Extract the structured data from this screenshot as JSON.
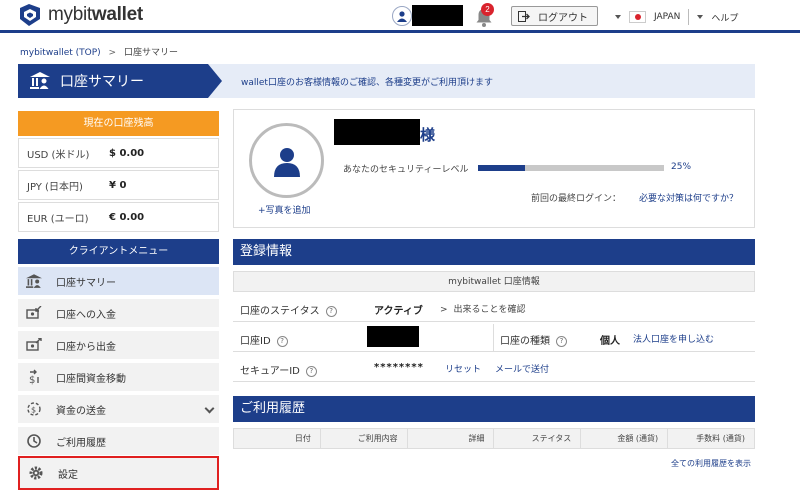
{
  "header": {
    "logo_text_light": "mybit",
    "logo_text_bold": "wallet",
    "notification_count": "2",
    "logout_label": "ログアウト",
    "language": "JAPAN",
    "help_label": "ヘルプ"
  },
  "breadcrumb": {
    "home": "mybitwallet (TOP)",
    "arrow": ">",
    "current": "口座サマリー"
  },
  "page": {
    "title": "口座サマリー",
    "description": "wallet口座のお客様情報のご確認、各種変更がご利用頂けます"
  },
  "balance": {
    "heading": "現在の口座残高",
    "rows": [
      {
        "currency": "USD (米ドル)",
        "amount": "$ 0.00"
      },
      {
        "currency": "JPY (日本円)",
        "amount": "¥ 0"
      },
      {
        "currency": "EUR (ユーロ)",
        "amount": "€ 0.00"
      }
    ]
  },
  "menu": {
    "heading": "クライアントメニュー",
    "items": [
      {
        "label": "口座サマリー",
        "icon": "bank-user-icon"
      },
      {
        "label": "口座への入金",
        "icon": "deposit-icon"
      },
      {
        "label": "口座から出金",
        "icon": "withdraw-icon"
      },
      {
        "label": "口座間資金移動",
        "icon": "transfer-icon"
      },
      {
        "label": "資金の送金",
        "icon": "remit-icon"
      },
      {
        "label": "ご利用履歴",
        "icon": "history-icon"
      },
      {
        "label": "設定",
        "icon": "gear-icon"
      }
    ]
  },
  "profile": {
    "add_photo": "+写真を追加",
    "name_suffix": "様",
    "security_label": "あなたのセキュリティーレベル",
    "security_level": 0.25,
    "security_pct": "25%",
    "last_login_label": "前回の最終ログイン：",
    "measures_link": "必要な対策は何ですか？"
  },
  "registration": {
    "heading": "登録情報",
    "subheading": "mybitwallet 口座情報",
    "status_label": "口座のステイタス",
    "status_value": "アクティブ",
    "status_link": "出来ることを確認",
    "status_link_prefix": ">",
    "account_id_label": "口座ID",
    "account_type_label": "口座の種類",
    "account_type_value": "個人",
    "corporate_link": "法人口座を申し込む",
    "secure_id_label": "セキュアーID",
    "secure_id_value": "********",
    "reset_link": "リセット",
    "email_link": "メールで送付",
    "help_glyph": "?"
  },
  "history": {
    "heading": "ご利用履歴",
    "columns": [
      "日付",
      "ご利用内容",
      "詳細",
      "ステイタス",
      "金額 (通貨)",
      "手数料 (通貨)"
    ],
    "all_link": "全ての利用履歴を表示"
  },
  "colors": {
    "brand_navy": "#1d3e8a",
    "balance_orange": "#f59a22",
    "alert_red": "#d9232d",
    "highlight_red": "#e02020"
  }
}
